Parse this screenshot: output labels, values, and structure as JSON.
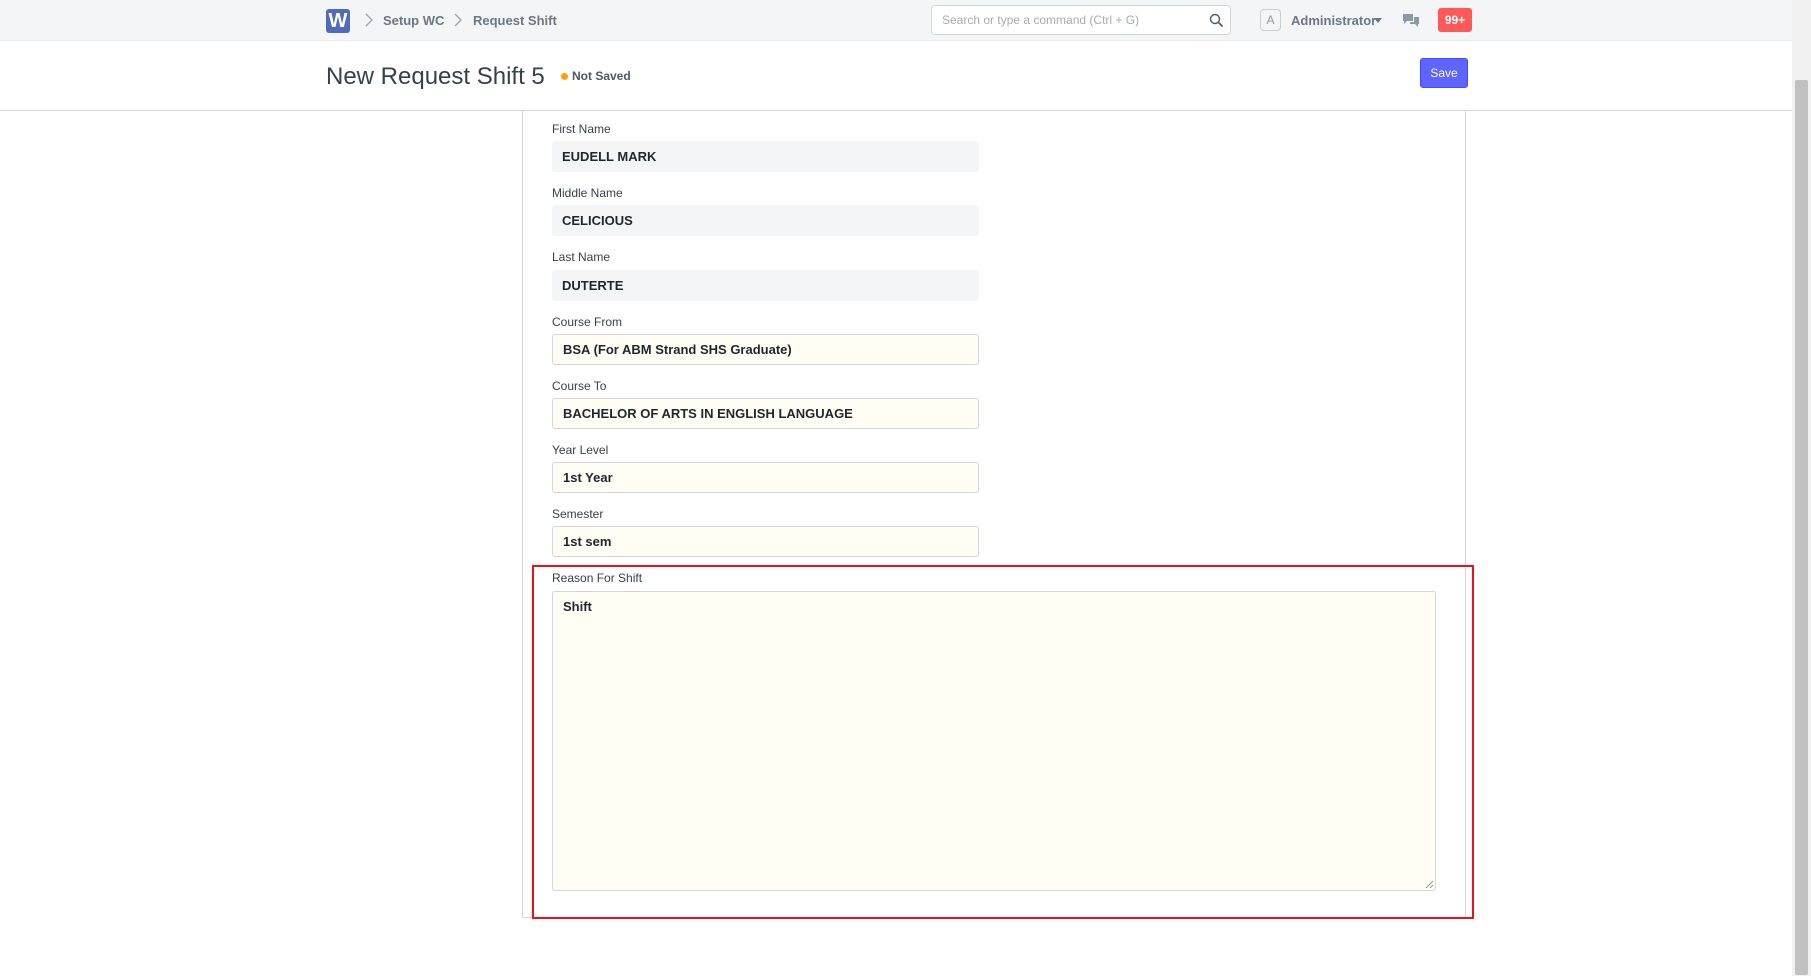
{
  "navbar": {
    "logo_letter": "W",
    "breadcrumbs": [
      "Setup WC",
      "Request Shift"
    ],
    "search_placeholder": "Search or type a command (Ctrl + G)",
    "avatar_letter": "A",
    "user_name": "Administrator",
    "notifications_badge": "99+"
  },
  "page": {
    "title": "New Request Shift 5",
    "status": "Not Saved",
    "save_label": "Save"
  },
  "form": {
    "first_name": {
      "label": "First Name",
      "value": "EUDELL MARK"
    },
    "middle_name": {
      "label": "Middle Name",
      "value": "CELICIOUS"
    },
    "last_name": {
      "label": "Last Name",
      "value": "DUTERTE"
    },
    "course_from": {
      "label": "Course From",
      "value": "BSA (For ABM Strand SHS Graduate)"
    },
    "course_to": {
      "label": "Course To",
      "value": "BACHELOR OF ARTS IN ENGLISH LANGUAGE"
    },
    "year_level": {
      "label": "Year Level",
      "value": "1st Year"
    },
    "semester": {
      "label": "Semester",
      "value": "1st sem"
    },
    "reason_for_shift": {
      "label": "Reason For Shift",
      "value": "Shift"
    }
  },
  "colors": {
    "primary": "#5e64ff",
    "highlight": "#e8121a",
    "status_indicator": "#ffa00a",
    "notification": "#ff5858"
  }
}
